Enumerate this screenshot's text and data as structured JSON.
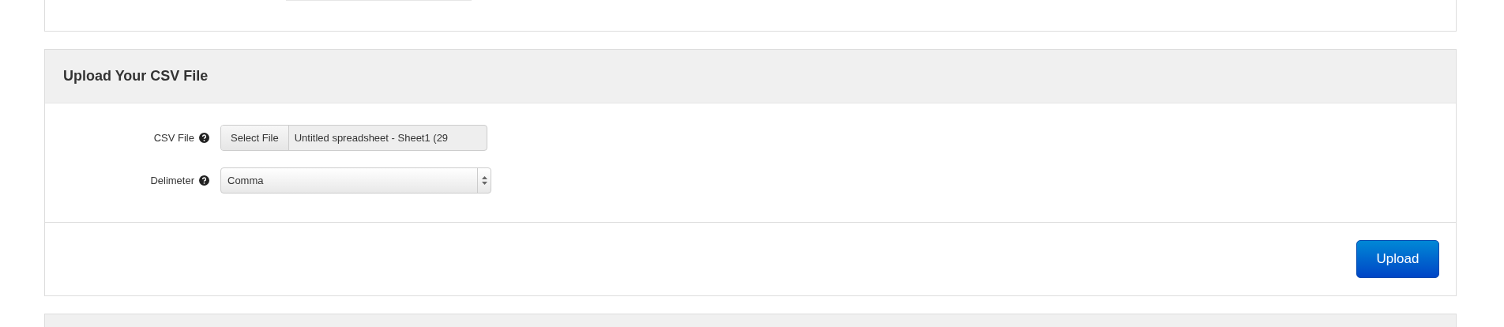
{
  "panel": {
    "title": "Upload Your CSV File"
  },
  "fields": [
    {
      "kind": "file",
      "label": "CSV File",
      "button": "Select File",
      "value": "Untitled spreadsheet - Sheet1 (29"
    },
    {
      "kind": "select",
      "label": "Delimeter",
      "value": "Comma"
    }
  ],
  "submit": "Upload"
}
